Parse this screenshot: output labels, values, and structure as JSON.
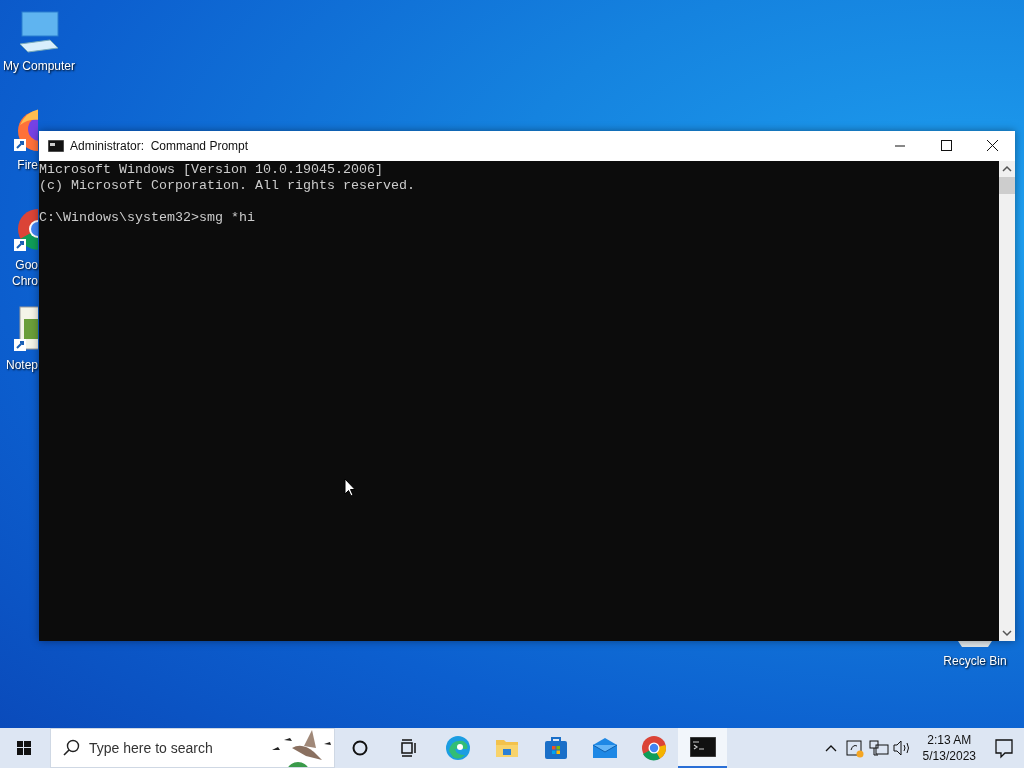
{
  "desktop_icons": [
    {
      "kind": "computer",
      "label_lines": [
        "My Computer"
      ]
    },
    {
      "kind": "firefox",
      "label_lines": [
        "Fire"
      ]
    },
    {
      "kind": "chrome",
      "label_lines": [
        "Goo",
        "Chro"
      ]
    },
    {
      "kind": "notepad",
      "label_lines": [
        "Notep"
      ]
    },
    {
      "kind": "recycle",
      "label_lines": [
        "Recycle Bin"
      ]
    }
  ],
  "window": {
    "title": "Administrator:  Command Prompt",
    "console": [
      [
        "Microsoft Windows [Version 10.0.19045.2006]",
        "(c) Microsoft Corporation. All rights reserved."
      ],
      [
        "C:\\Windows\\system32>smg *hi"
      ]
    ]
  },
  "taskbar": {
    "search": {
      "placeholder": "Type here to search"
    },
    "apps": [
      {
        "kind": "cortana",
        "selected": false
      },
      {
        "kind": "taskview",
        "selected": false
      },
      {
        "kind": "edge",
        "selected": false
      },
      {
        "kind": "explorer",
        "selected": false
      },
      {
        "kind": "store",
        "selected": false
      },
      {
        "kind": "mail",
        "selected": false
      },
      {
        "kind": "chrome",
        "selected": false
      },
      {
        "kind": "cmd",
        "selected": true
      }
    ],
    "clock": {
      "time": "2:13 AM",
      "date": "5/13/2023"
    }
  }
}
